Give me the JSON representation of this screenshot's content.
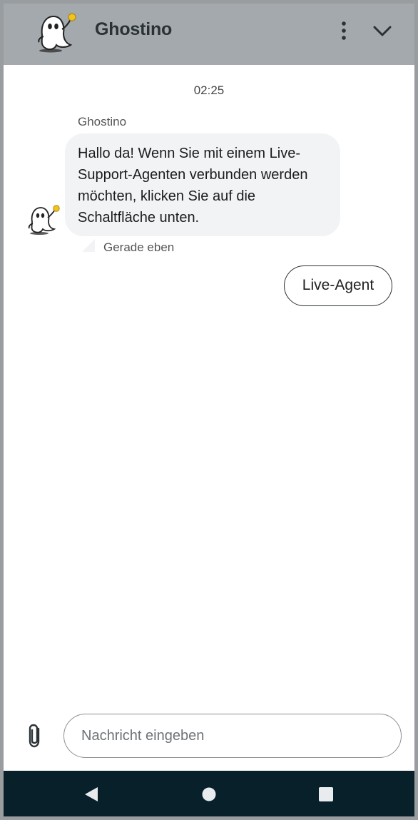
{
  "header": {
    "title": "Ghostino",
    "avatar_icon": "ghost-mascot-icon",
    "menu_icon": "more-vert-icon",
    "collapse_icon": "chevron-down-icon"
  },
  "conversation": {
    "timestamp": "02:25",
    "sender": "Ghostino",
    "message": {
      "text": "Hallo da! Wenn Sie mit einem Live-Support-Agenten verbunden werden möchten, klicken Sie auf die Schaltfläche unten.",
      "time": "Gerade eben"
    },
    "quick_reply": "Live-Agent"
  },
  "composer": {
    "attach_icon": "paperclip-icon",
    "placeholder": "Nachricht eingeben"
  },
  "navbar": {
    "back_icon": "back-triangle-icon",
    "home_icon": "home-circle-icon",
    "recents_icon": "recents-square-icon"
  },
  "colors": {
    "header_bg": "#a3a9ad",
    "bubble_bg": "#f2f3f5",
    "navbar_bg": "#08202a"
  }
}
